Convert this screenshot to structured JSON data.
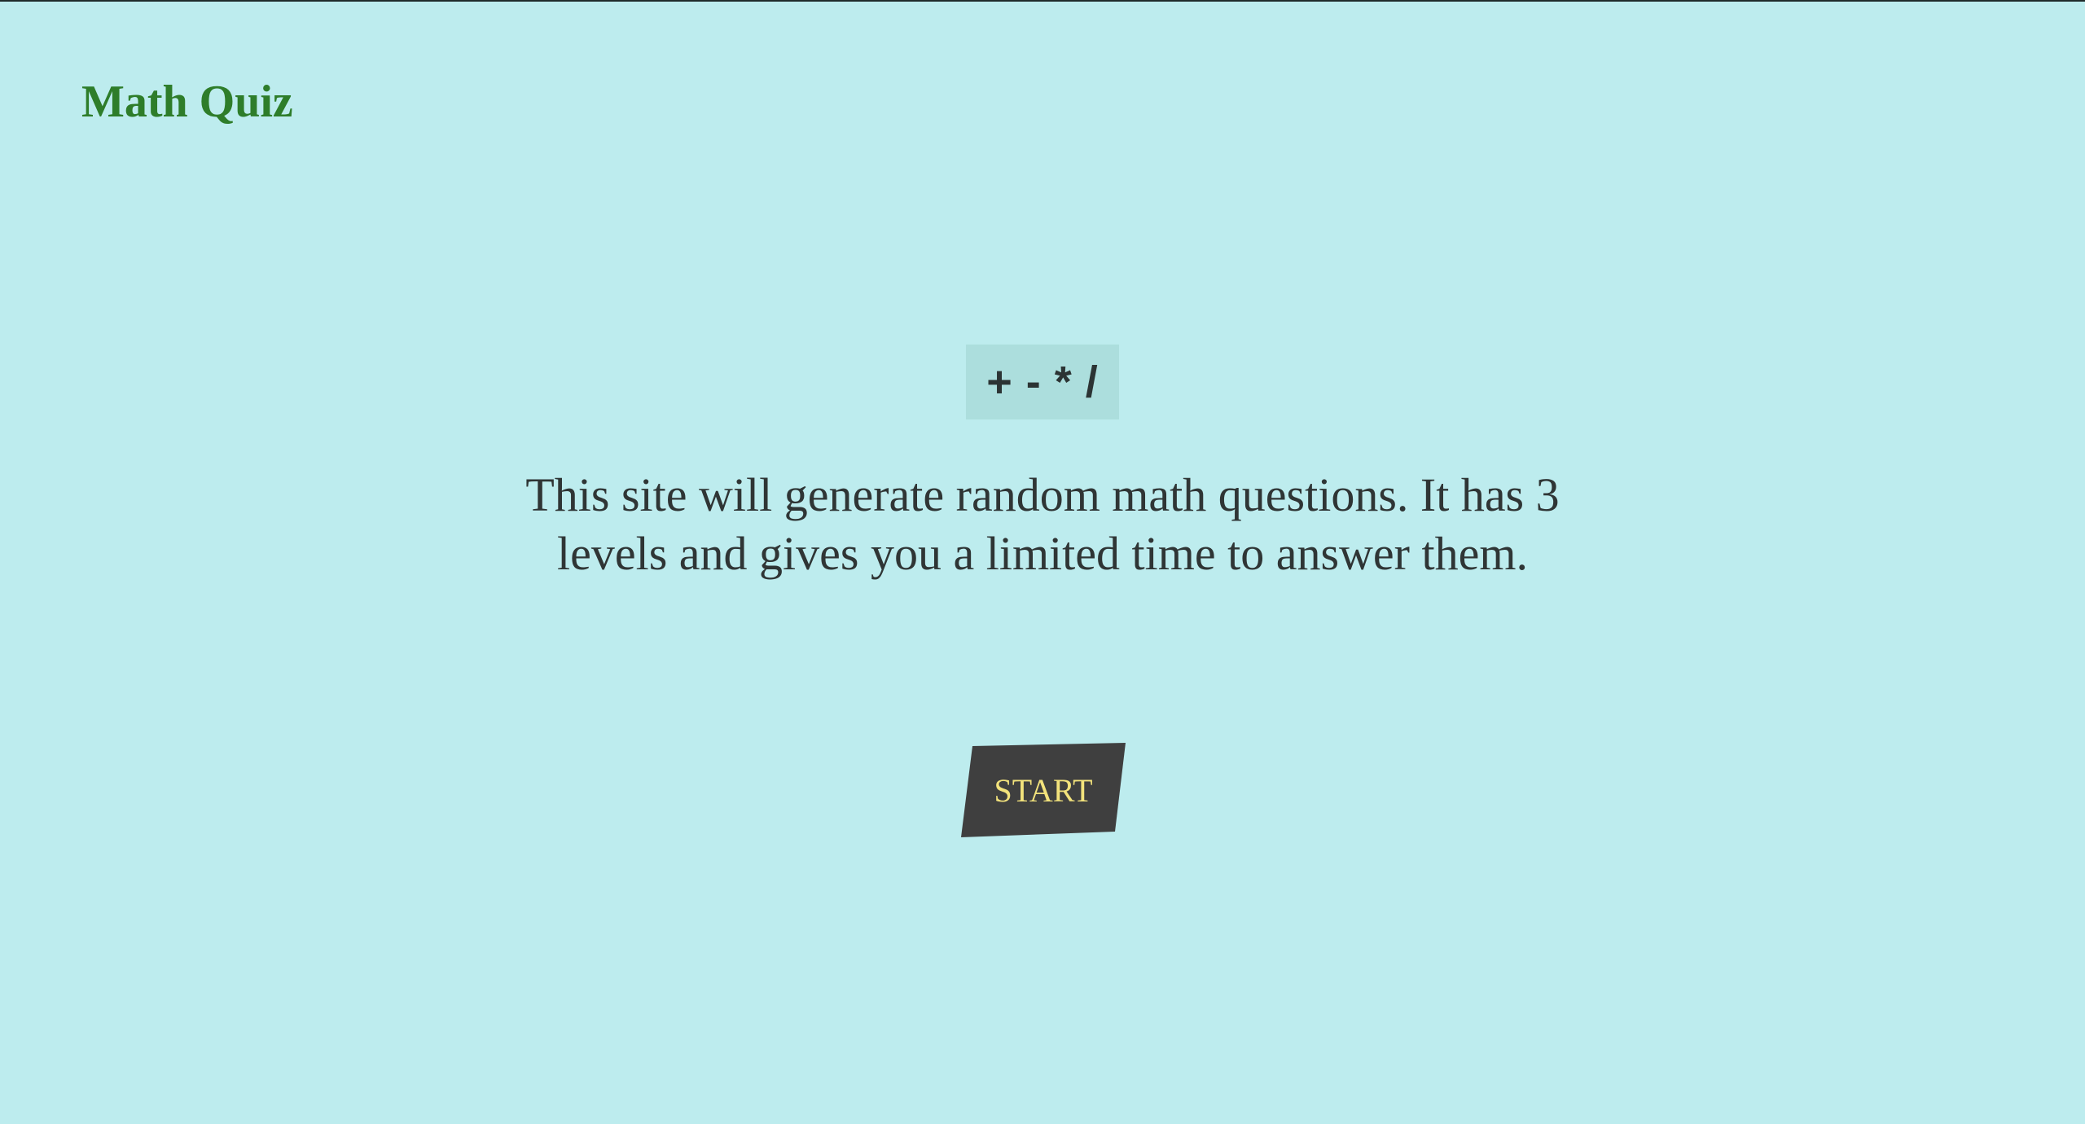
{
  "header": {
    "title": "Math Quiz"
  },
  "hero": {
    "operators": "+ - * /",
    "description": "This site will generate random math questions. It has 3 levels and gives you a limited time to answer them.",
    "start_label": "START"
  },
  "colors": {
    "background": "#bdecee",
    "title": "#2e7d2a",
    "operators_bg": "#acdedd",
    "text": "#2f3535",
    "button_bg": "#3f3f3f",
    "button_text": "#f3e37c"
  }
}
